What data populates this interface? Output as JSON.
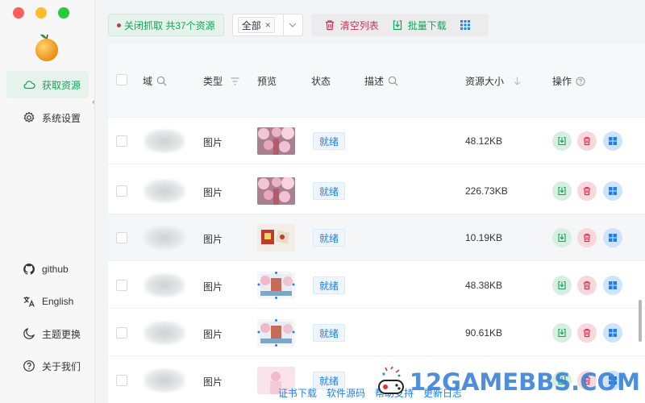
{
  "sidebar": {
    "items": [
      {
        "label": "获取资源",
        "icon": "cloud-icon",
        "active": true
      },
      {
        "label": "系统设置",
        "icon": "gear-icon",
        "active": false
      }
    ],
    "bottom": [
      {
        "label": "github",
        "icon": "github-icon"
      },
      {
        "label": "English",
        "icon": "translate-icon"
      },
      {
        "label": "主题更换",
        "icon": "moon-icon"
      },
      {
        "label": "关于我们",
        "icon": "help-circle-icon"
      }
    ]
  },
  "toolbar": {
    "capture_label": "关闭抓取 共37个资源",
    "filter_tag": "全部",
    "clear_label": "清空列表",
    "batch_download_label": "批量下载"
  },
  "table": {
    "headers": {
      "domain": "域",
      "type": "类型",
      "preview": "预览",
      "status": "状态",
      "description": "描述",
      "size": "资源大小",
      "actions": "操作"
    },
    "rows": [
      {
        "type": "图片",
        "status": "就绪",
        "size": "48.12KB",
        "preview": "blossom"
      },
      {
        "type": "图片",
        "status": "就绪",
        "size": "226.73KB",
        "preview": "blossom"
      },
      {
        "type": "图片",
        "status": "就绪",
        "size": "10.19KB",
        "preview": "red-card"
      },
      {
        "type": "图片",
        "status": "就绪",
        "size": "48.38KB",
        "preview": "temple"
      },
      {
        "type": "图片",
        "status": "就绪",
        "size": "90.61KB",
        "preview": "temple"
      },
      {
        "type": "图片",
        "status": "就绪",
        "size": "",
        "preview": "pink"
      }
    ]
  },
  "footer": {
    "links": [
      "证书下载",
      "软件源码",
      "帮助支持",
      "更新日志"
    ]
  },
  "watermark": {
    "text": "12GAMEBBS.COM"
  },
  "colors": {
    "accent_green": "#18a058",
    "danger_red": "#d03050",
    "info_blue": "#2080f0"
  }
}
